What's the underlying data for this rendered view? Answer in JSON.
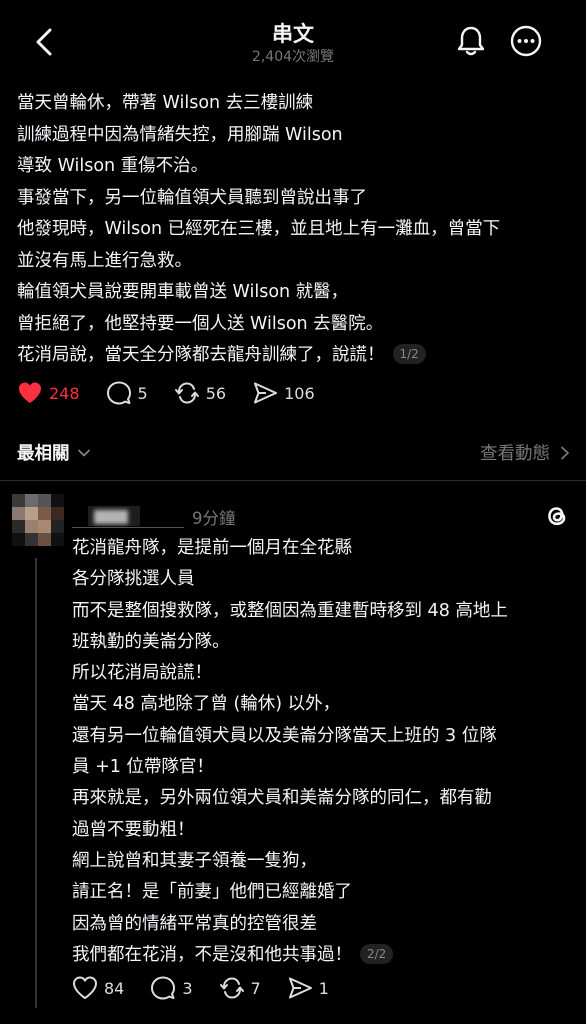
{
  "header": {
    "title": "串文",
    "views": "2,404次瀏覽"
  },
  "post": {
    "lines": [
      "當天曾輪休，帶著 Wilson 去三樓訓練",
      "訓練過程中因為情緒失控，用腳踹 Wilson",
      "導致 Wilson 重傷不治。",
      "事發當下，另一位輪值領犬員聽到曾說出事了",
      "他發現時，Wilson 已經死在三樓，並且地上有一灘血，曾當下",
      "並沒有馬上進行急救。",
      "輪值領犬員說要開車載曾送 Wilson 就醫，",
      "曾拒絕了，他堅持要一個人送 Wilson 去醫院。",
      "花消局說，當天全分隊都去龍舟訓練了，說謊！"
    ],
    "page_badge": "1/2",
    "likes": "248",
    "comments": "5",
    "reposts": "56",
    "shares": "106"
  },
  "sort": {
    "label": "最相關",
    "view_activity": "查看動態"
  },
  "reply": {
    "time": "9分鐘",
    "lines": [
      "花消龍舟隊，是提前一個月在全花縣",
      "各分隊挑選人員",
      "而不是整個搜救隊，或整個因為重建暫時移到 48 高地上",
      "班執勤的美崙分隊。",
      "所以花消局說謊！",
      "當天 48 高地除了曾 (輪休) 以外，",
      "還有另一位輪值領犬員以及美崙分隊當天上班的 3 位隊",
      "員 +1 位帶隊官！",
      "再來就是，另外兩位領犬員和美崙分隊的同仁，都有勸",
      "過曾不要動粗！",
      "網上說曾和其妻子領養一隻狗，",
      "請正名！是「前妻」他們已經離婚了",
      "因為曾的情緒平常真的控管很差",
      "我們都在花消，不是沒和他共事過！"
    ],
    "page_badge": "2/2",
    "likes": "84",
    "comments": "3",
    "reposts": "7",
    "shares": "1"
  },
  "colors": {
    "background": "#000000",
    "like_red": "#ff3040",
    "muted": "#777777"
  },
  "icons": [
    "back-arrow-icon",
    "bell-icon",
    "more-icon",
    "heart-icon",
    "comment-icon",
    "repost-icon",
    "share-icon",
    "chevron-down-icon",
    "chevron-right-icon",
    "threads-logo-icon"
  ]
}
